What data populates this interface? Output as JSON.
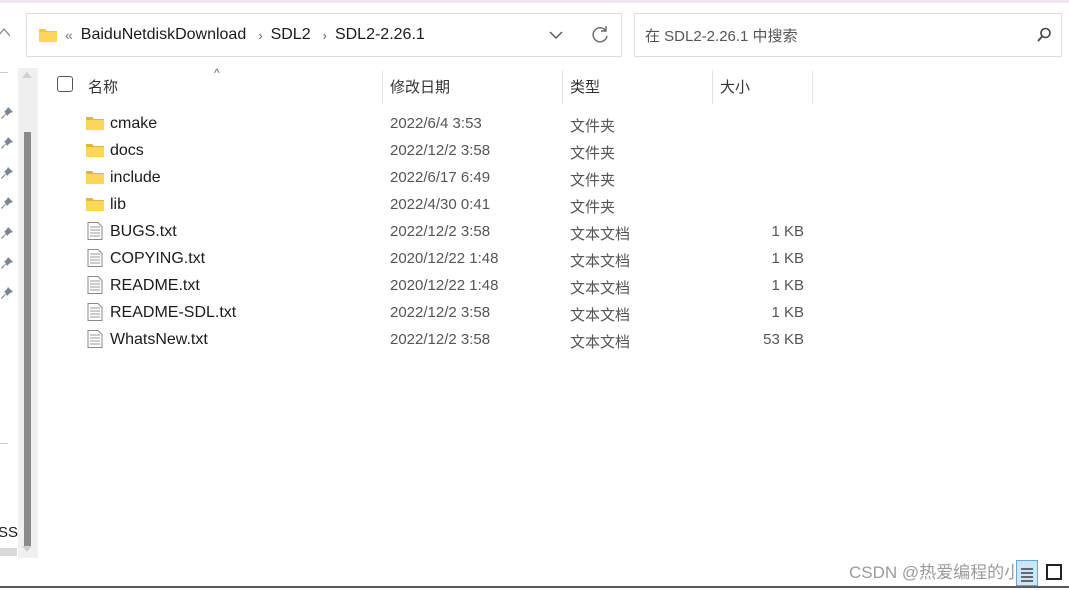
{
  "address_bar": {
    "overflow_glyph": "«",
    "breadcrumbs": [
      "BaiduNetdiskDownload",
      "SDL2",
      "SDL2-2.26.1"
    ],
    "separator": "›",
    "icons": [
      "folder-icon",
      "chevron-down-icon",
      "refresh-icon"
    ]
  },
  "search": {
    "placeholder": "在 SDL2-2.26.1 中搜索",
    "icon": "search-icon"
  },
  "navigation": {
    "up_glyph": "^",
    "pinned_count": 7,
    "partial_label": "SSI"
  },
  "columns": {
    "name": "名称",
    "date": "修改日期",
    "type": "类型",
    "size": "大小",
    "sort_indicator": "^"
  },
  "files": [
    {
      "name": "cmake",
      "date": "2022/6/4 3:53",
      "type": "文件夹",
      "size": "",
      "kind": "folder"
    },
    {
      "name": "docs",
      "date": "2022/12/2 3:58",
      "type": "文件夹",
      "size": "",
      "kind": "folder"
    },
    {
      "name": "include",
      "date": "2022/6/17 6:49",
      "type": "文件夹",
      "size": "",
      "kind": "folder"
    },
    {
      "name": "lib",
      "date": "2022/4/30 0:41",
      "type": "文件夹",
      "size": "",
      "kind": "folder"
    },
    {
      "name": "BUGS.txt",
      "date": "2022/12/2 3:58",
      "type": "文本文档",
      "size": "1 KB",
      "kind": "text"
    },
    {
      "name": "COPYING.txt",
      "date": "2020/12/22 1:48",
      "type": "文本文档",
      "size": "1 KB",
      "kind": "text"
    },
    {
      "name": "README.txt",
      "date": "2020/12/22 1:48",
      "type": "文本文档",
      "size": "1 KB",
      "kind": "text"
    },
    {
      "name": "README-SDL.txt",
      "date": "2022/12/2 3:58",
      "type": "文本文档",
      "size": "1 KB",
      "kind": "text"
    },
    {
      "name": "WhatsNew.txt",
      "date": "2022/12/2 3:58",
      "type": "文本文档",
      "size": "53 KB",
      "kind": "text"
    }
  ],
  "watermark": "CSDN @热爱编程的小K",
  "colors": {
    "folder": "#f5c542",
    "folder_tab": "#e8b530",
    "view_selected_bg": "#cfe5f5",
    "view_selected_border": "#6aa7d5"
  }
}
